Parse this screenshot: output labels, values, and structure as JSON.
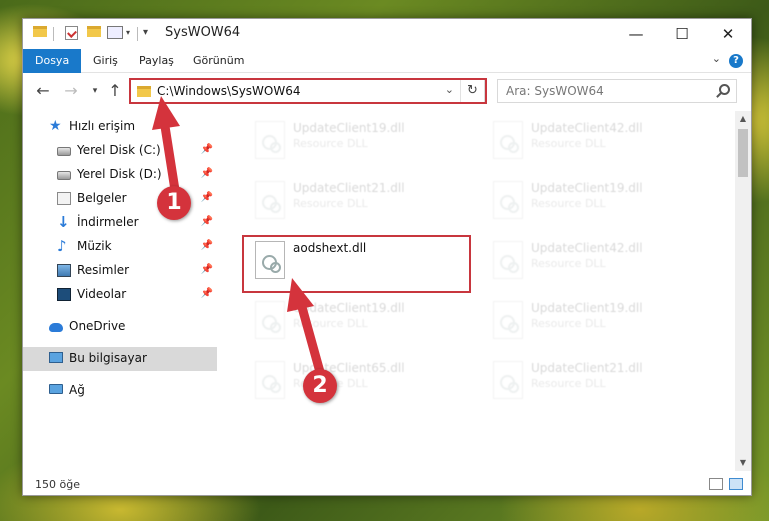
{
  "window": {
    "title": "SysWOW64"
  },
  "ribbon": {
    "tabs": [
      "Dosya",
      "Giriş",
      "Paylaş",
      "Görünüm"
    ]
  },
  "address": {
    "path": "C:\\Windows\\SysWOW64"
  },
  "search": {
    "placeholder": "Ara: SysWOW64"
  },
  "sidebar": {
    "items": [
      {
        "label": "Hızlı erişim",
        "icon": "star-icon"
      },
      {
        "label": "Yerel Disk (C:)",
        "icon": "drive-icon",
        "pinned": true
      },
      {
        "label": "Yerel Disk (D:)",
        "icon": "drive-icon",
        "pinned": true
      },
      {
        "label": "Belgeler",
        "icon": "documents-icon",
        "pinned": true
      },
      {
        "label": "İndirmeler",
        "icon": "downloads-icon",
        "pinned": true
      },
      {
        "label": "Müzik",
        "icon": "music-icon",
        "pinned": true
      },
      {
        "label": "Resimler",
        "icon": "pictures-icon",
        "pinned": true
      },
      {
        "label": "Videolar",
        "icon": "videos-icon",
        "pinned": true
      },
      {
        "label": "OneDrive",
        "icon": "cloud-icon"
      },
      {
        "label": "Bu bilgisayar",
        "icon": "computer-icon",
        "selected": true
      },
      {
        "label": "Ağ",
        "icon": "network-icon"
      }
    ]
  },
  "files": [
    {
      "name": "UpdateClient19.dll",
      "type": "Resource DLL"
    },
    {
      "name": "UpdateClient42.dll",
      "type": "Resource DLL"
    },
    {
      "name": "UpdateClient21.dll",
      "type": "Resource DLL"
    },
    {
      "name": "UpdateClient19.dll",
      "type": "Resource DLL"
    },
    {
      "name": "aodshext.dll",
      "type": ""
    },
    {
      "name": "UpdateClient42.dll",
      "type": "Resource DLL"
    },
    {
      "name": "UpdateClient19.dll",
      "type": "Resource DLL"
    },
    {
      "name": "UpdateClient19.dll",
      "type": "Resource DLL"
    },
    {
      "name": "UpdateClient65.dll",
      "type": "Resource DLL"
    },
    {
      "name": "UpdateClient21.dll",
      "type": "Resource DLL"
    }
  ],
  "status": {
    "item_count": "150 öğe"
  },
  "callouts": [
    "1",
    "2"
  ],
  "colors": {
    "accent": "#1979ca",
    "highlight": "#c8363e",
    "callout": "#d4333c"
  }
}
